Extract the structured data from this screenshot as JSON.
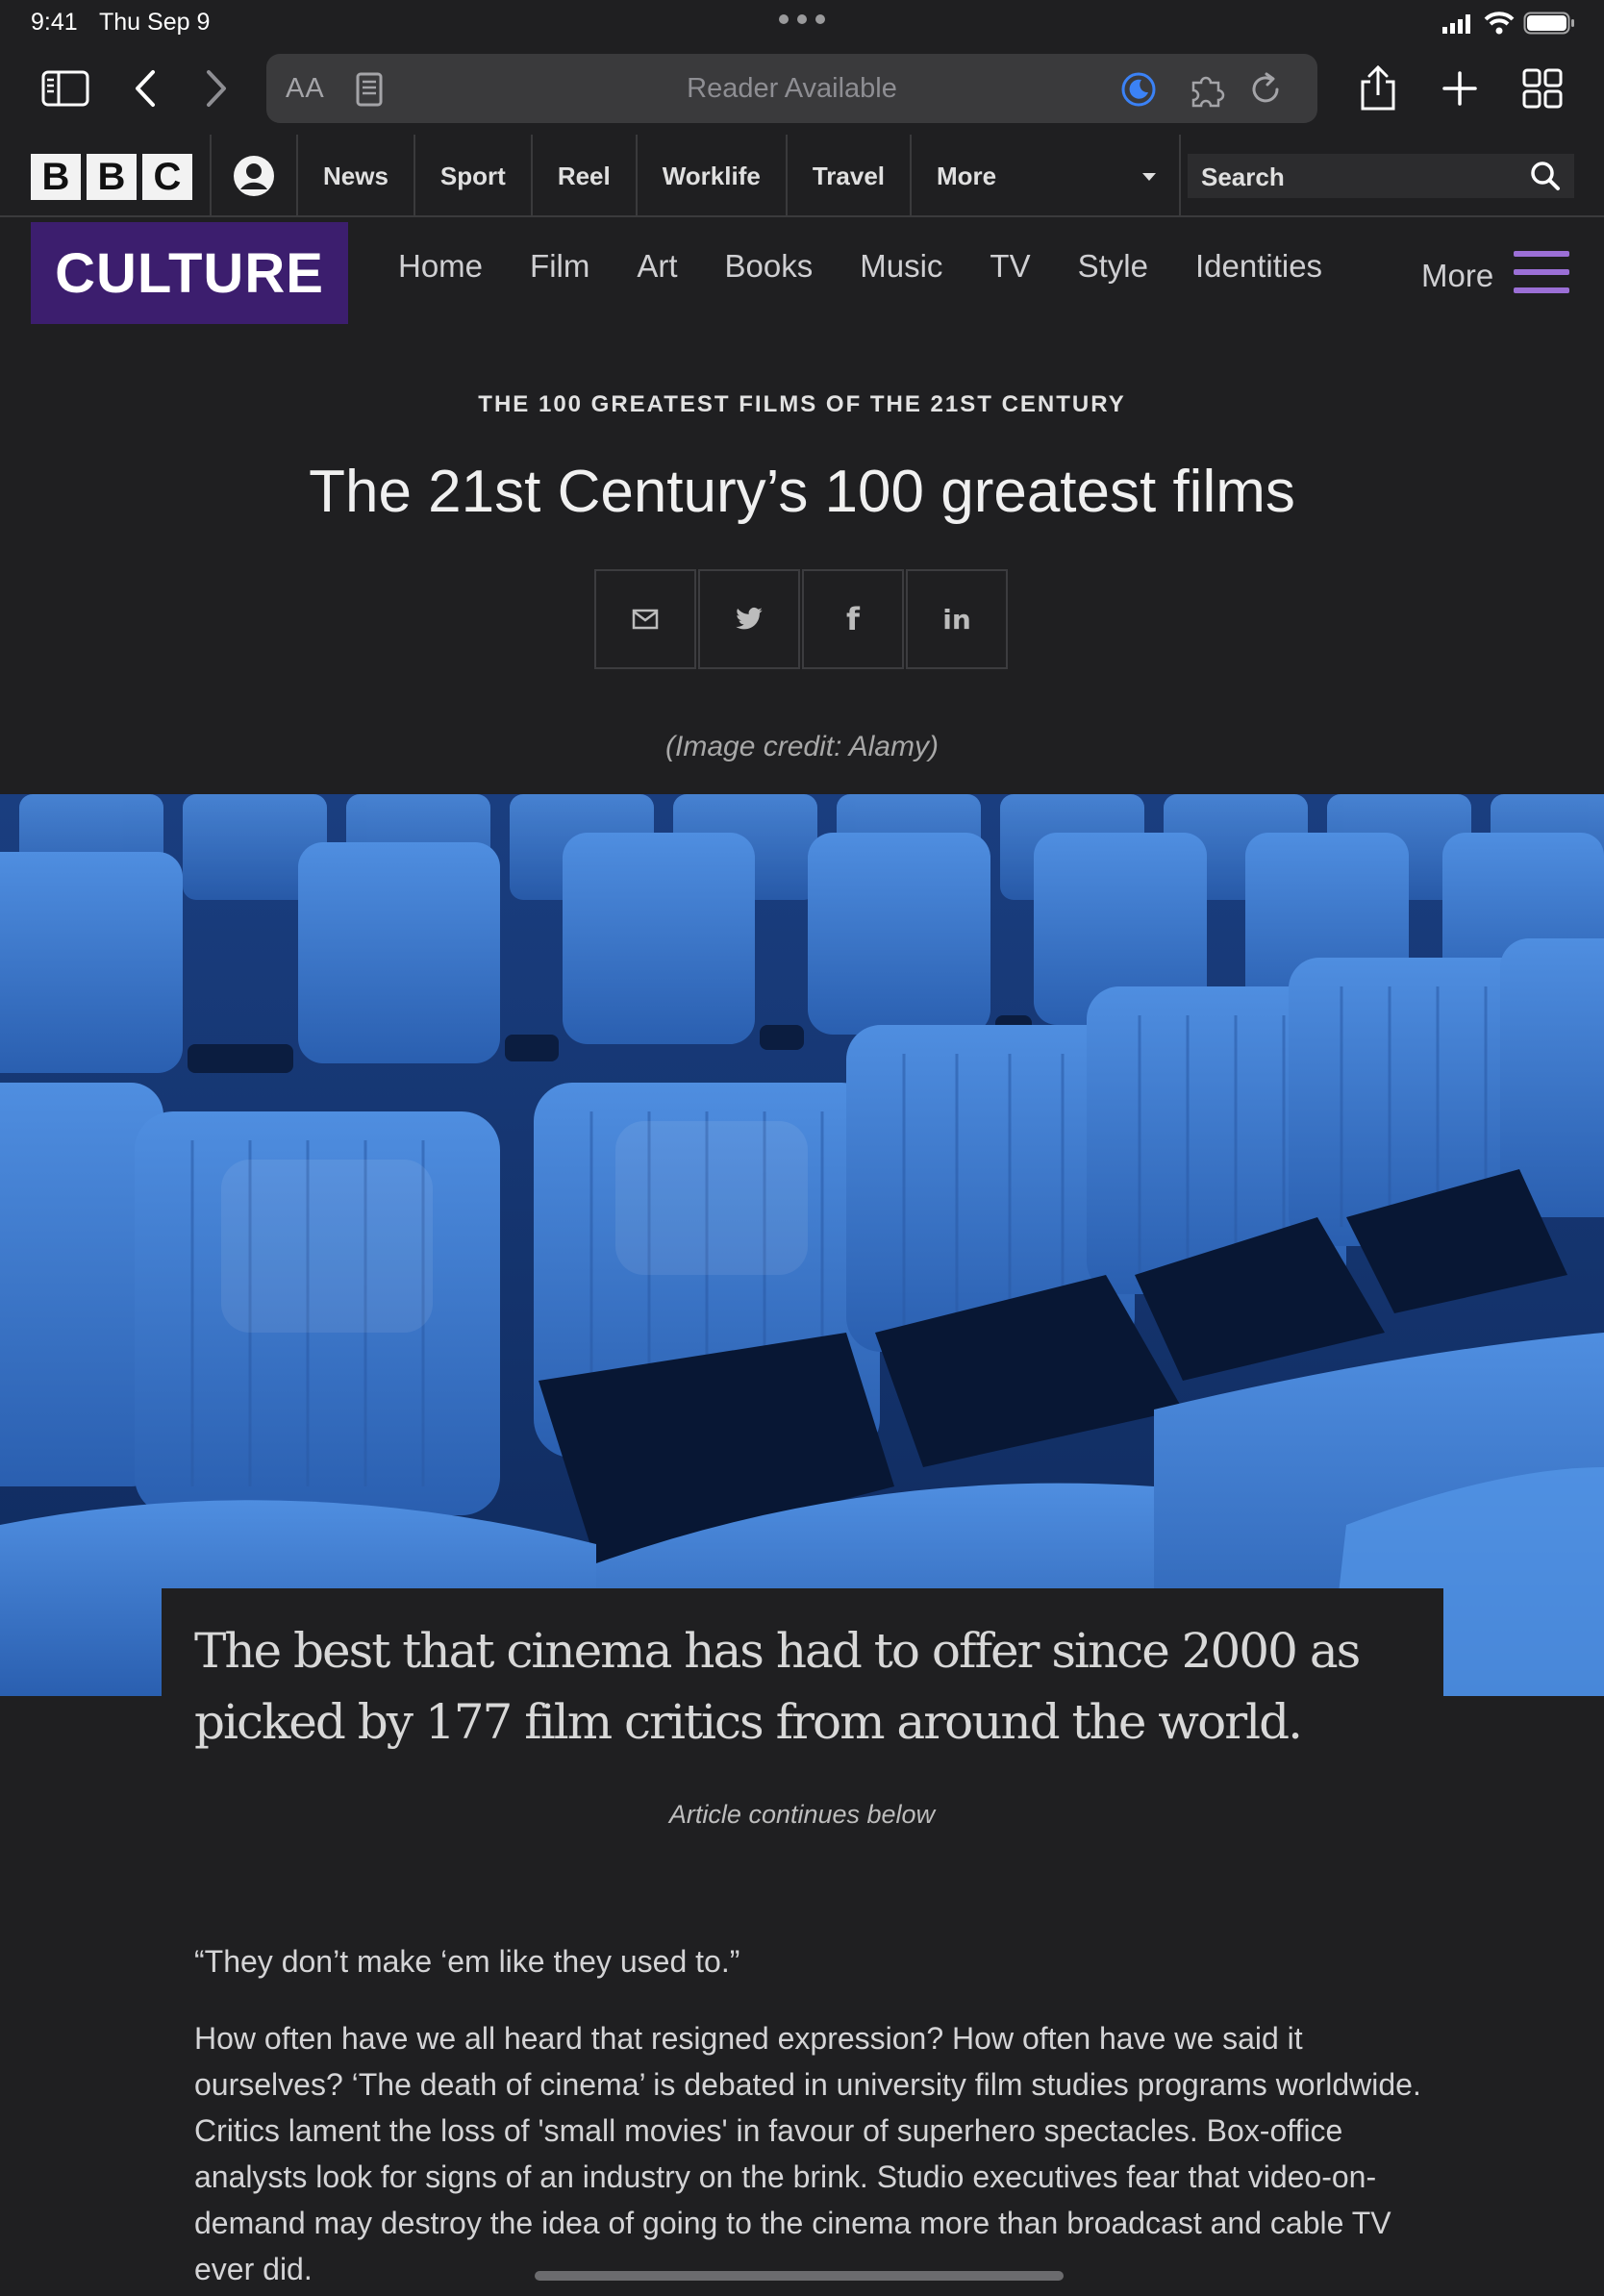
{
  "status_bar": {
    "time": "9:41",
    "date": "Thu Sep 9"
  },
  "browser": {
    "text_size_label": "AA",
    "url_text": "Reader Available"
  },
  "masthead": {
    "logo_letters": [
      "B",
      "B",
      "C"
    ],
    "nav": [
      "News",
      "Sport",
      "Reel",
      "Worklife",
      "Travel",
      "More"
    ],
    "search_label": "Search"
  },
  "culture": {
    "logo": "CULTURE",
    "nav": [
      "Home",
      "Film",
      "Art",
      "Books",
      "Music",
      "TV",
      "Style",
      "Identities"
    ],
    "more_label": "More",
    "accent": "#3c1e6e",
    "menu_color": "#9b6fd6"
  },
  "article": {
    "kicker": "THE 100 GREATEST FILMS OF THE 21ST CENTURY",
    "headline": "The 21st Century’s 100 greatest films",
    "share_icons": [
      "email-icon",
      "twitter-icon",
      "facebook-icon",
      "linkedin-icon"
    ],
    "share_facebook_glyph": "f",
    "share_linkedin_glyph": "in",
    "image_credit": "(Image credit: Alamy)",
    "summary": "The best that cinema has had to offer since 2000 as picked by 177 film critics from around the world.",
    "continues": "Article continues below",
    "paragraphs": [
      "“They don’t make ‘em like they used to.”",
      "How often have we all heard that resigned expression? How often have we said it ourselves? ‘The death of cinema’ is debated in university film studies programs worldwide. Critics lament the loss of 'small movies' in favour of superhero spectacles. Box-office analysts look for signs of an industry on the brink. Studio executives fear that video-on-demand may destroy the idea of going to the cinema more than broadcast and cable TV ever did."
    ]
  }
}
